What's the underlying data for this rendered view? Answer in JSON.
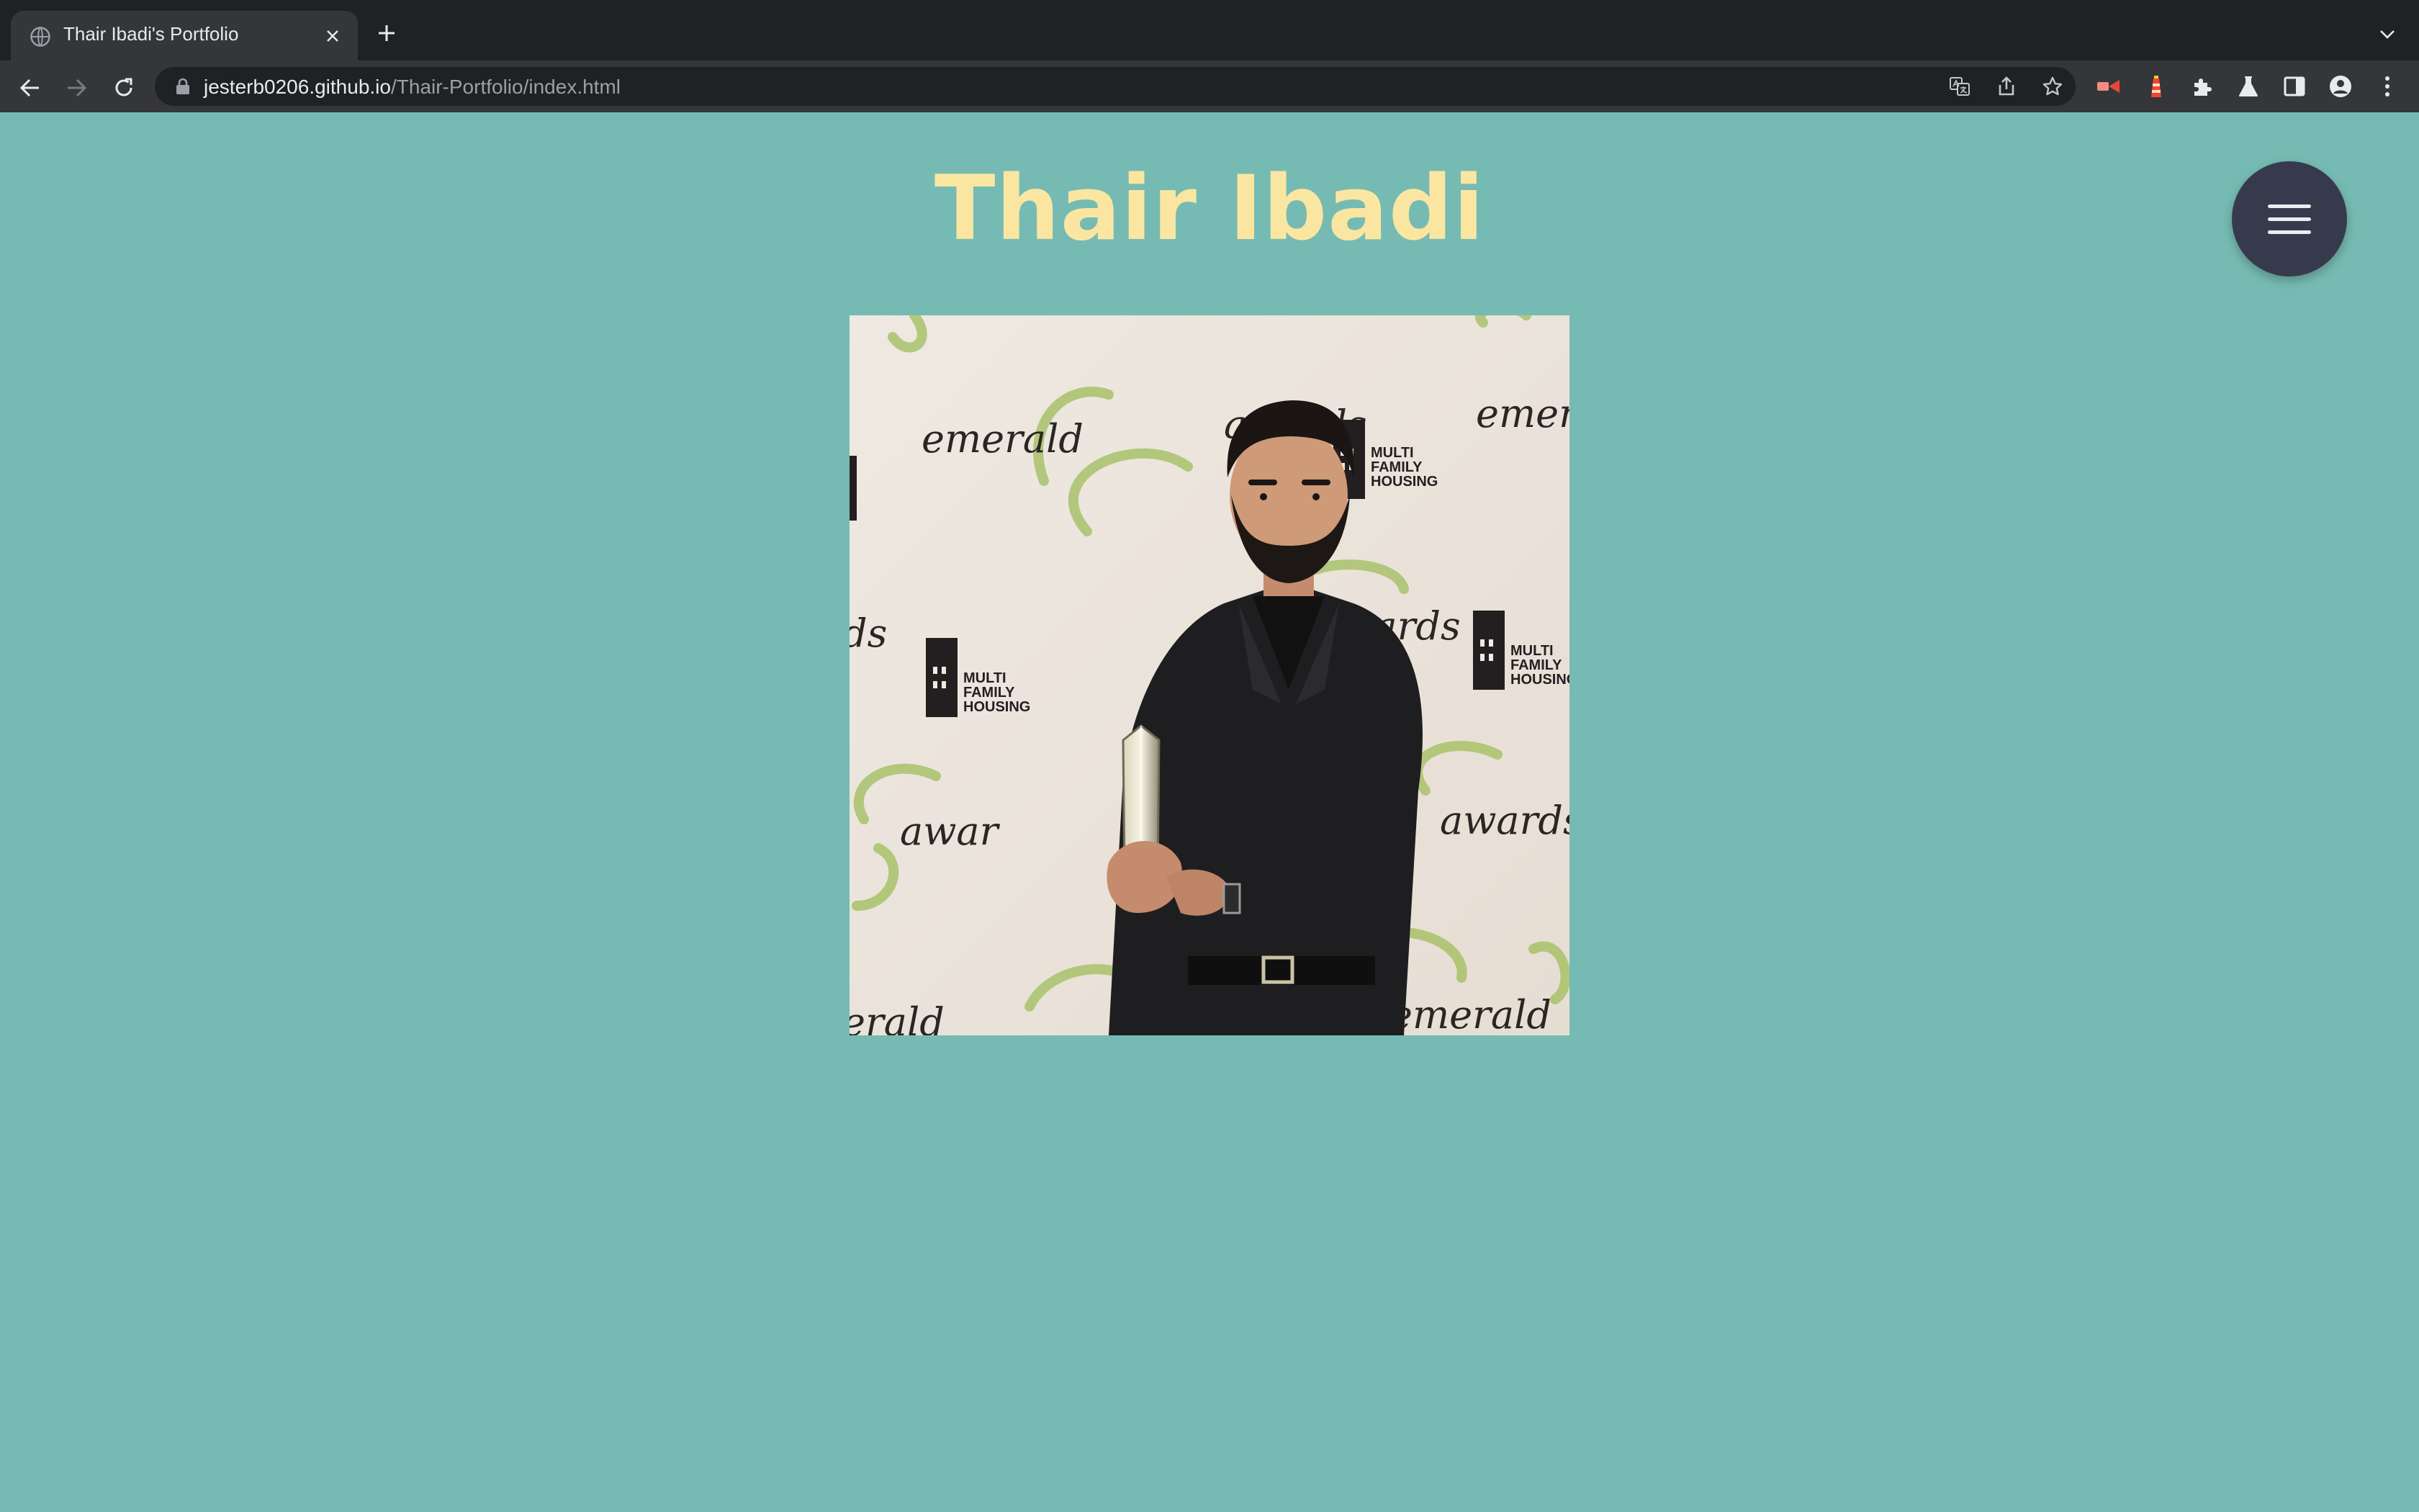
{
  "browser": {
    "tab_title": "Thair Ibadi's Portfolio",
    "url_host": "jesterb0206.github.io",
    "url_path": "/Thair-Portfolio/index.html"
  },
  "page": {
    "title": "Thair Ibadi",
    "background_color": "#76bbb3",
    "title_color": "#fbe6a1",
    "menu_button_color": "#373a4d"
  },
  "photo": {
    "alt": "Thair Ibadi holding an award",
    "backdrop_words": [
      "emerald",
      "awards",
      "emer",
      "awards",
      "awards",
      "emerald"
    ],
    "logo_text": [
      "MULTI",
      "FAMILY",
      "HOUSING"
    ]
  },
  "icons": {
    "favicon": "globe-icon",
    "tab_close": "close-icon",
    "new_tab": "plus-icon",
    "tab_search": "chevron-down-icon",
    "back": "arrow-left-icon",
    "forward": "arrow-right-icon",
    "reload": "reload-icon",
    "lock": "lock-icon",
    "translate": "translate-icon",
    "share": "share-icon",
    "bookmark": "star-icon",
    "menu": "hamburger-icon"
  }
}
